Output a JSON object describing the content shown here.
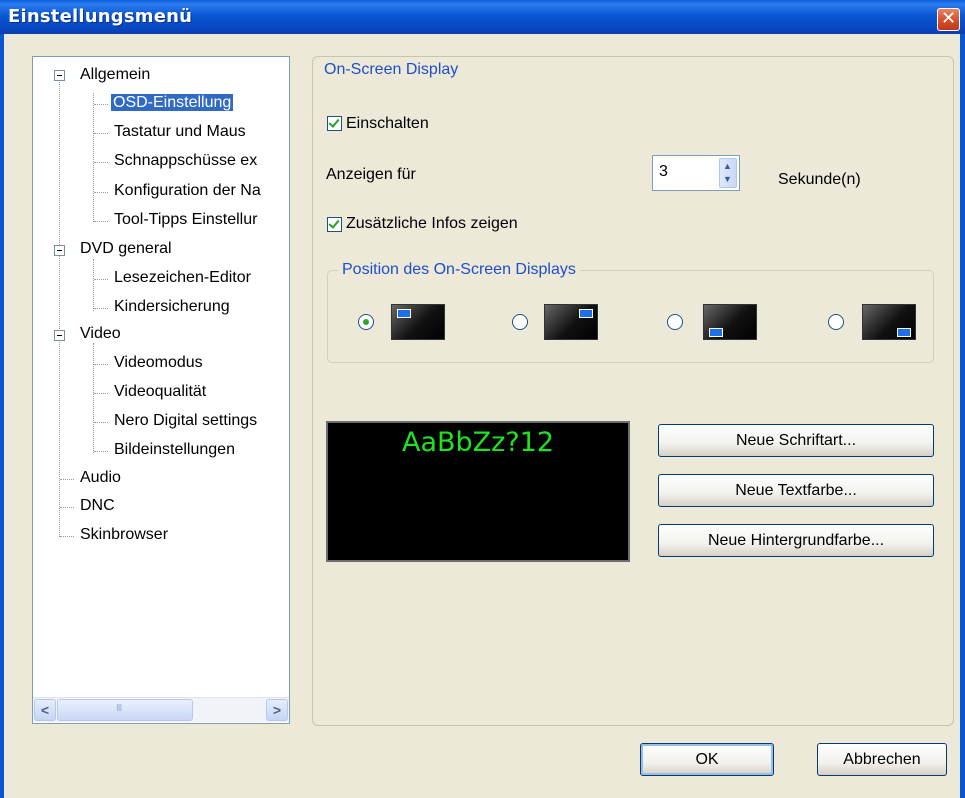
{
  "window": {
    "title": "Einstellungsmenü",
    "close_glyph": "✕"
  },
  "tree": {
    "items": [
      {
        "label": "Allgemein"
      },
      {
        "label": "OSD-Einstellung"
      },
      {
        "label": "Tastatur und Maus"
      },
      {
        "label": "Schnappschüsse ex"
      },
      {
        "label": "Konfiguration der Na"
      },
      {
        "label": "Tool-Tipps Einstellur"
      },
      {
        "label": "DVD general"
      },
      {
        "label": "Lesezeichen-Editor"
      },
      {
        "label": "Kindersicherung"
      },
      {
        "label": "Video"
      },
      {
        "label": "Videomodus"
      },
      {
        "label": "Videoqualität"
      },
      {
        "label": "Nero Digital settings"
      },
      {
        "label": "Bildeinstellungen"
      },
      {
        "label": "Audio"
      },
      {
        "label": "DNC"
      },
      {
        "label": "Skinbrowser"
      }
    ],
    "selected": "OSD-Einstellung",
    "scroll_left": "<",
    "scroll_right": ">",
    "thumb_grip": "III"
  },
  "osd": {
    "group_title": "On-Screen Display",
    "enable_label": "Einschalten",
    "enable_checked": true,
    "show_for_label": "Anzeigen für",
    "show_for_value": "3",
    "seconds_label": "Sekunde(n)",
    "extra_info_label": "Zusätzliche Infos zeigen",
    "extra_info_checked": true,
    "position_group_title": "Position des On-Screen Displays",
    "positions": [
      "top-left",
      "top-right",
      "bottom-left",
      "bottom-right"
    ],
    "selected_position": "top-left",
    "preview_text": "AaBbZz?12",
    "preview_text_color": "#1ee31e",
    "preview_bg_color": "#000000",
    "new_font_button": "Neue Schriftart...",
    "new_text_color_button": "Neue Textfarbe...",
    "new_bg_color_button": "Neue Hintergrundfarbe..."
  },
  "footer": {
    "ok_label": "OK",
    "cancel_label": "Abbrechen"
  },
  "colors": {
    "titlebar": "#0a58d4",
    "dialog_bg": "#ece9d8",
    "selection": "#316ac5",
    "legend_text": "#1f4fc8"
  }
}
